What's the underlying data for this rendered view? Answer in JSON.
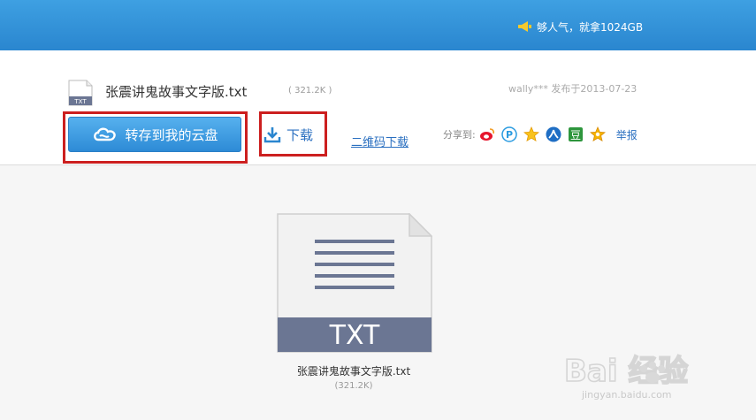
{
  "header": {
    "promo_text": "够人气，就拿1024GB"
  },
  "file": {
    "icon_label": "TXT",
    "name": "张震讲鬼故事文字版.txt",
    "size": "( 321.2K )",
    "meta": "wally*** 发布于2013-07-23"
  },
  "actions": {
    "save_label": "转存到我的云盘",
    "download_label": "下载",
    "qr_label": "二维码下载"
  },
  "share": {
    "label": "分享到:",
    "report_label": "举报"
  },
  "preview": {
    "type_label": "TXT",
    "name": "张震讲鬼故事文字版.txt",
    "size": "(321.2K)"
  },
  "watermark": {
    "brand": "Bai 经验",
    "url": "jingyan.baidu.com"
  },
  "colors": {
    "topbar": "#2a86cf",
    "highlight": "#cc1f1f",
    "link": "#2a6fc0",
    "doc_band": "#6b7693"
  }
}
